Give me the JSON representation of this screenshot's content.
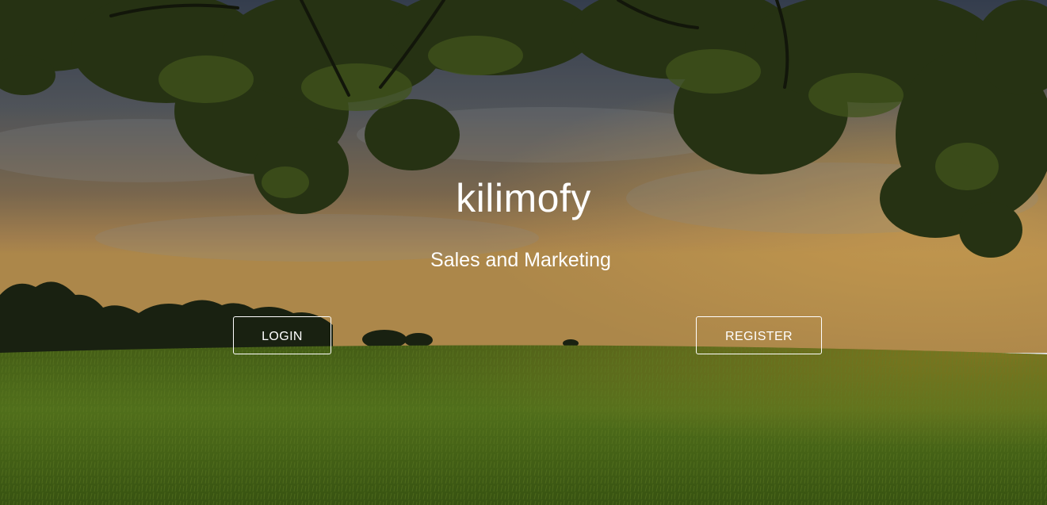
{
  "hero": {
    "brand": "kilimofy",
    "tagline": "Sales and Marketing",
    "background": "sunset-meadow-under-tree-canopy"
  },
  "actions": {
    "login_label": "LOGIN",
    "register_label": "REGISTER"
  },
  "colors": {
    "text": "#ffffff",
    "button_border": "#ffffff",
    "sky_top": "#4a5566",
    "sky_horizon": "#c89a52",
    "grass": "#5d7c1e",
    "foliage": "#2a3a14"
  }
}
